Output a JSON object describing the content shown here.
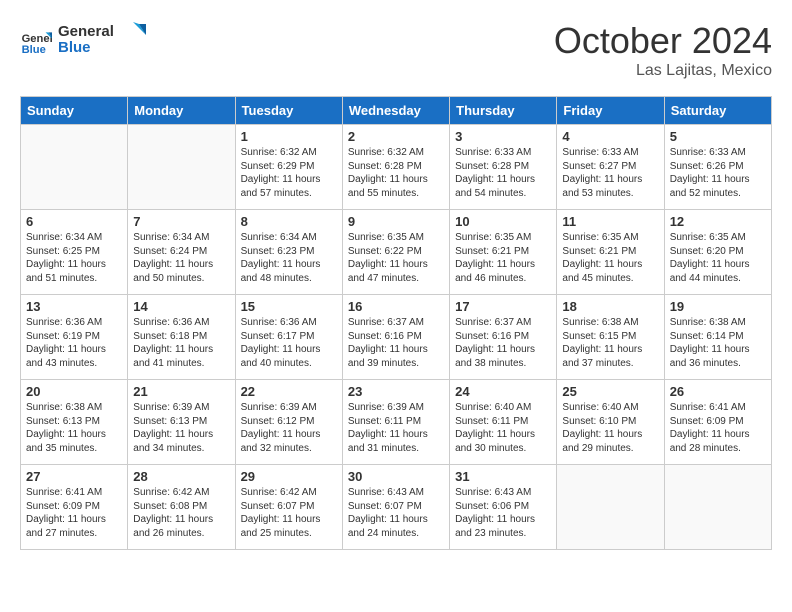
{
  "header": {
    "logo_line1": "General",
    "logo_line2": "Blue",
    "month": "October 2024",
    "location": "Las Lajitas, Mexico"
  },
  "weekdays": [
    "Sunday",
    "Monday",
    "Tuesday",
    "Wednesday",
    "Thursday",
    "Friday",
    "Saturday"
  ],
  "days": [
    {
      "num": "",
      "empty": true
    },
    {
      "num": "",
      "empty": true
    },
    {
      "num": "1",
      "rise": "6:32 AM",
      "set": "6:29 PM",
      "daylight": "11 hours and 57 minutes."
    },
    {
      "num": "2",
      "rise": "6:32 AM",
      "set": "6:28 PM",
      "daylight": "11 hours and 55 minutes."
    },
    {
      "num": "3",
      "rise": "6:33 AM",
      "set": "6:28 PM",
      "daylight": "11 hours and 54 minutes."
    },
    {
      "num": "4",
      "rise": "6:33 AM",
      "set": "6:27 PM",
      "daylight": "11 hours and 53 minutes."
    },
    {
      "num": "5",
      "rise": "6:33 AM",
      "set": "6:26 PM",
      "daylight": "11 hours and 52 minutes."
    },
    {
      "num": "6",
      "rise": "6:34 AM",
      "set": "6:25 PM",
      "daylight": "11 hours and 51 minutes."
    },
    {
      "num": "7",
      "rise": "6:34 AM",
      "set": "6:24 PM",
      "daylight": "11 hours and 50 minutes."
    },
    {
      "num": "8",
      "rise": "6:34 AM",
      "set": "6:23 PM",
      "daylight": "11 hours and 48 minutes."
    },
    {
      "num": "9",
      "rise": "6:35 AM",
      "set": "6:22 PM",
      "daylight": "11 hours and 47 minutes."
    },
    {
      "num": "10",
      "rise": "6:35 AM",
      "set": "6:21 PM",
      "daylight": "11 hours and 46 minutes."
    },
    {
      "num": "11",
      "rise": "6:35 AM",
      "set": "6:21 PM",
      "daylight": "11 hours and 45 minutes."
    },
    {
      "num": "12",
      "rise": "6:35 AM",
      "set": "6:20 PM",
      "daylight": "11 hours and 44 minutes."
    },
    {
      "num": "13",
      "rise": "6:36 AM",
      "set": "6:19 PM",
      "daylight": "11 hours and 43 minutes."
    },
    {
      "num": "14",
      "rise": "6:36 AM",
      "set": "6:18 PM",
      "daylight": "11 hours and 41 minutes."
    },
    {
      "num": "15",
      "rise": "6:36 AM",
      "set": "6:17 PM",
      "daylight": "11 hours and 40 minutes."
    },
    {
      "num": "16",
      "rise": "6:37 AM",
      "set": "6:16 PM",
      "daylight": "11 hours and 39 minutes."
    },
    {
      "num": "17",
      "rise": "6:37 AM",
      "set": "6:16 PM",
      "daylight": "11 hours and 38 minutes."
    },
    {
      "num": "18",
      "rise": "6:38 AM",
      "set": "6:15 PM",
      "daylight": "11 hours and 37 minutes."
    },
    {
      "num": "19",
      "rise": "6:38 AM",
      "set": "6:14 PM",
      "daylight": "11 hours and 36 minutes."
    },
    {
      "num": "20",
      "rise": "6:38 AM",
      "set": "6:13 PM",
      "daylight": "11 hours and 35 minutes."
    },
    {
      "num": "21",
      "rise": "6:39 AM",
      "set": "6:13 PM",
      "daylight": "11 hours and 34 minutes."
    },
    {
      "num": "22",
      "rise": "6:39 AM",
      "set": "6:12 PM",
      "daylight": "11 hours and 32 minutes."
    },
    {
      "num": "23",
      "rise": "6:39 AM",
      "set": "6:11 PM",
      "daylight": "11 hours and 31 minutes."
    },
    {
      "num": "24",
      "rise": "6:40 AM",
      "set": "6:11 PM",
      "daylight": "11 hours and 30 minutes."
    },
    {
      "num": "25",
      "rise": "6:40 AM",
      "set": "6:10 PM",
      "daylight": "11 hours and 29 minutes."
    },
    {
      "num": "26",
      "rise": "6:41 AM",
      "set": "6:09 PM",
      "daylight": "11 hours and 28 minutes."
    },
    {
      "num": "27",
      "rise": "6:41 AM",
      "set": "6:09 PM",
      "daylight": "11 hours and 27 minutes."
    },
    {
      "num": "28",
      "rise": "6:42 AM",
      "set": "6:08 PM",
      "daylight": "11 hours and 26 minutes."
    },
    {
      "num": "29",
      "rise": "6:42 AM",
      "set": "6:07 PM",
      "daylight": "11 hours and 25 minutes."
    },
    {
      "num": "30",
      "rise": "6:43 AM",
      "set": "6:07 PM",
      "daylight": "11 hours and 24 minutes."
    },
    {
      "num": "31",
      "rise": "6:43 AM",
      "set": "6:06 PM",
      "daylight": "11 hours and 23 minutes."
    },
    {
      "num": "",
      "empty": true
    },
    {
      "num": "",
      "empty": true
    }
  ],
  "labels": {
    "sunrise": "Sunrise:",
    "sunset": "Sunset:",
    "daylight": "Daylight:"
  }
}
